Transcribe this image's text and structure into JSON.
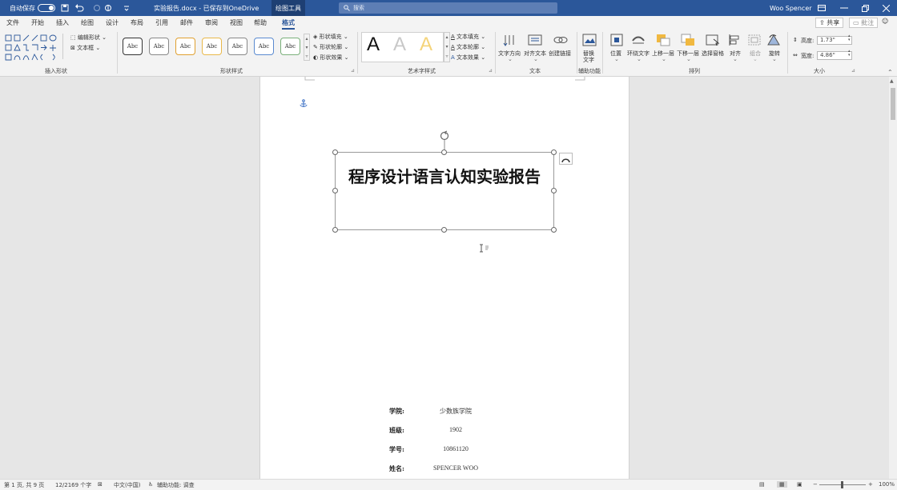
{
  "titlebar": {
    "autosave_label": "自动保存",
    "autosave_state": "关",
    "doc_title": "实验报告.docx - 已保存到OneDrive",
    "contextual_tab": "绘图工具",
    "search_placeholder": "搜索",
    "user_name": "Woo Spencer"
  },
  "menu": [
    "文件",
    "开始",
    "插入",
    "绘图",
    "设计",
    "布局",
    "引用",
    "邮件",
    "审阅",
    "视图",
    "帮助",
    "格式"
  ],
  "menu_active_index": 11,
  "share": {
    "share_label": "共享",
    "comment_label": "批注"
  },
  "ribbon": {
    "insert_shapes": {
      "edit_shape": "编辑形状",
      "text_box": "文本框",
      "label": "插入形状"
    },
    "shape_styles": {
      "sample_label": "Abc",
      "fill": "形状填充",
      "outline": "形状轮廓",
      "effect": "形状效果",
      "label": "形状样式"
    },
    "wordart": {
      "letter": "A",
      "fill": "文本填充",
      "outline": "文本轮廓",
      "effect": "文本效果",
      "label": "艺术字样式"
    },
    "text": {
      "direction": "文字方向",
      "align": "对齐文本",
      "link": "创建链接",
      "label": "文本"
    },
    "accessibility": {
      "alt_text_line1": "替换",
      "alt_text_line2": "文字",
      "label": "辅助功能"
    },
    "arrange": {
      "position": "位置",
      "wrap": "环绕文字",
      "forward": "上移一层",
      "backward": "下移一层",
      "pane": "选择窗格",
      "align": "对齐",
      "group": "组合",
      "rotate": "旋转",
      "label": "排列"
    },
    "size": {
      "height_label": "高度:",
      "height_value": "1.73\"",
      "width_label": "宽度:",
      "width_value": "4.86\"",
      "label": "大小"
    }
  },
  "document": {
    "title": "程序设计语言认知实验报告",
    "fields": [
      {
        "label": "学院:",
        "value": "少数族学院"
      },
      {
        "label": "班级:",
        "value": "1902"
      },
      {
        "label": "学号:",
        "value": "10861120"
      },
      {
        "label": "姓名:",
        "value": "SPENCER WOO"
      }
    ]
  },
  "statusbar": {
    "page": "第 1 页, 共 9 页",
    "words": "12/2169 个字",
    "language": "中文(中国)",
    "accessibility": "辅助功能: 调查",
    "zoom": "100%"
  },
  "colors": {
    "accent": "#2b579a",
    "ribbon_bg": "#f3f3f3",
    "canvas": "#e6e6e6"
  }
}
